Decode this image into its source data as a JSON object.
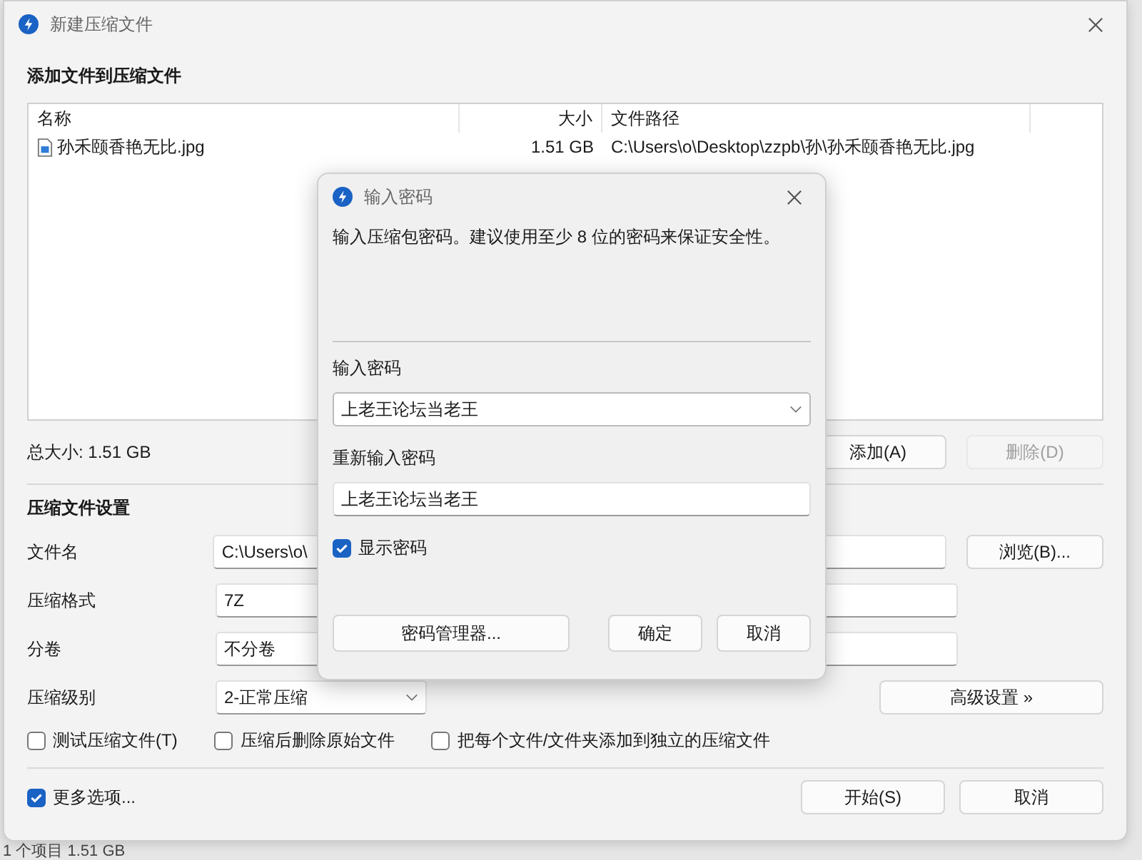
{
  "window": {
    "title": "新建压缩文件"
  },
  "files_section": {
    "title": "添加文件到压缩文件",
    "columns": [
      {
        "label": "名称"
      },
      {
        "label": "大小"
      },
      {
        "label": "文件路径"
      }
    ],
    "rows": [
      {
        "name": "孙禾颐香艳无比.jpg",
        "size": "1.51 GB",
        "path": "C:\\Users\\o\\Desktop\\zzpb\\孙\\孙禾颐香艳无比.jpg"
      }
    ],
    "total": "总大小: 1.51 GB",
    "buttons": [
      {
        "label": "添加(A)",
        "disabled": false
      },
      {
        "label": "删除(D)",
        "disabled": true
      }
    ]
  },
  "settings": {
    "title": "压缩文件设置",
    "fields": [
      {
        "label": "文件名",
        "value": "C:\\Users\\o\\",
        "kind": "text"
      },
      {
        "label": "压缩格式",
        "value": "7Z",
        "kind": "select"
      },
      {
        "label": "分卷",
        "value": "不分卷",
        "kind": "select"
      },
      {
        "label": "压缩级别",
        "value": "2-正常压缩",
        "kind": "dropdown"
      }
    ],
    "browse_button": "浏览(B)...",
    "advanced_button": "高级设置 »",
    "options": [
      {
        "label": "测试压缩文件(T)",
        "checked": false
      },
      {
        "label": "压缩后删除原始文件",
        "checked": false
      },
      {
        "label": "把每个文件/文件夹添加到独立的压缩文件",
        "checked": false
      }
    ]
  },
  "footer": {
    "more_options": {
      "label": "更多选项...",
      "checked": true
    },
    "buttons": [
      "开始(S)",
      "取消"
    ]
  },
  "status_bar": "1 个项目  1.51 GB",
  "password_dialog": {
    "title": "输入密码",
    "message": "输入压缩包密码。建议使用至少 8 位的密码来保证安全性。",
    "password_label": "输入密码",
    "password_value": "上老王论坛当老王",
    "confirm_label": "重新输入密码",
    "confirm_value": "上老王论坛当老王",
    "show_password": {
      "label": "显示密码",
      "checked": true
    },
    "manager_button": "密码管理器...",
    "buttons": [
      "确定",
      "取消"
    ]
  }
}
